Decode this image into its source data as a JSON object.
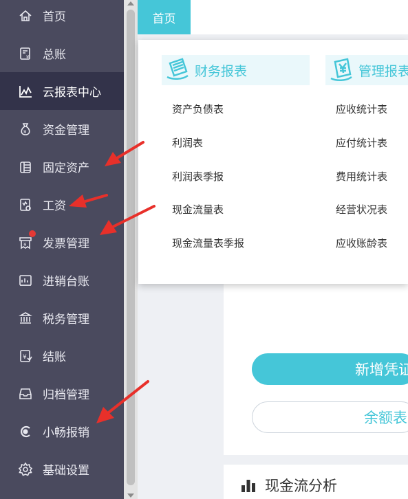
{
  "sidebar": {
    "items": [
      {
        "label": "首页",
        "icon": "home-icon"
      },
      {
        "label": "总账",
        "icon": "ledger-icon"
      },
      {
        "label": "云报表中心",
        "icon": "chart-line-icon",
        "active": true
      },
      {
        "label": "资金管理",
        "icon": "money-bag-icon"
      },
      {
        "label": "固定资产",
        "icon": "building-icon"
      },
      {
        "label": "工资",
        "icon": "payroll-icon"
      },
      {
        "label": "发票管理",
        "icon": "invoice-icon",
        "badge": "dot"
      },
      {
        "label": "进销台账",
        "icon": "inventory-icon"
      },
      {
        "label": "税务管理",
        "icon": "tax-icon"
      },
      {
        "label": "结账",
        "icon": "closing-icon"
      },
      {
        "label": "归档管理",
        "icon": "archive-icon"
      },
      {
        "label": "小畅报销",
        "icon": "reimburse-icon"
      },
      {
        "label": "基础设置",
        "icon": "gear-icon"
      }
    ]
  },
  "header": {
    "home_tab": "首页"
  },
  "dropdown": {
    "columns": [
      {
        "title": "财务报表",
        "icon": "document-icon",
        "links": [
          "资产负债表",
          "利润表",
          "利润表季报",
          "现金流量表",
          "现金流量表季报"
        ]
      },
      {
        "title": "管理报表",
        "icon": "yen-report-icon",
        "links": [
          "应收统计表",
          "应付统计表",
          "费用统计表",
          "经营状况表",
          "应收账龄表"
        ]
      }
    ]
  },
  "main": {
    "new_voucher_button": "新增凭证",
    "balance_button": "余额表",
    "analysis_title": "现金流分析"
  },
  "colors": {
    "accent": "#45c6d8",
    "sidebar_bg": "#4a4a5e",
    "sidebar_active": "#33334a",
    "badge": "#e53935",
    "annotation": "#e8302a"
  }
}
